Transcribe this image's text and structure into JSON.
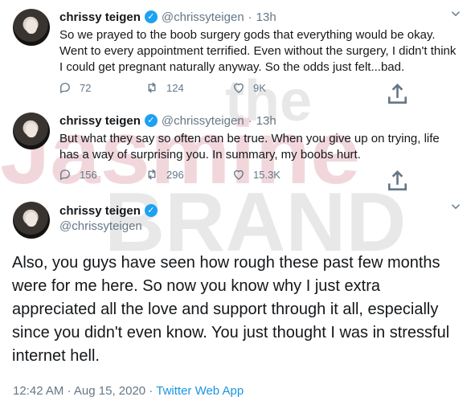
{
  "watermark": {
    "text_line1": "the",
    "text_line2": "Jasmine",
    "text_line3": "BRAND"
  },
  "tweets": [
    {
      "name": "chrissy teigen",
      "handle": "@chrissyteigen",
      "separator": "·",
      "time": "13h",
      "text": "So we prayed to the boob surgery gods that everything would be okay. Went to every appointment terrified. Even without the surgery, I didn't think I could get pregnant naturally anyway. So the odds just felt...bad.",
      "replies": "72",
      "retweets": "124",
      "likes": "9K"
    },
    {
      "name": "chrissy teigen",
      "handle": "@chrissyteigen",
      "separator": "·",
      "time": "13h",
      "text": "But what they say so often can be true. When you give up on trying, life has a way of surprising you. In summary, my boobs hurt.",
      "replies": "156",
      "retweets": "296",
      "likes": "15.3K"
    }
  ],
  "main_tweet": {
    "name": "chrissy teigen",
    "handle": "@chrissyteigen",
    "text": "Also, you guys have seen how rough these past few months were for me here. So now you know why I just extra appreciated all the love and support through it all, especially since you didn't even know. You just thought I was in stressful internet hell.",
    "time": "12:42 AM",
    "separator1": "·",
    "date": "Aug 15, 2020",
    "separator2": "·",
    "source": "Twitter Web App"
  },
  "icons": [
    "verified-icon",
    "reply-icon",
    "retweet-icon",
    "like-icon",
    "share-icon",
    "chevron-down-icon"
  ],
  "colors": {
    "accent": "#1da1f2",
    "secondary_text": "#657786",
    "source_link": "#1b95e0",
    "watermark": "#e6b8c1"
  }
}
